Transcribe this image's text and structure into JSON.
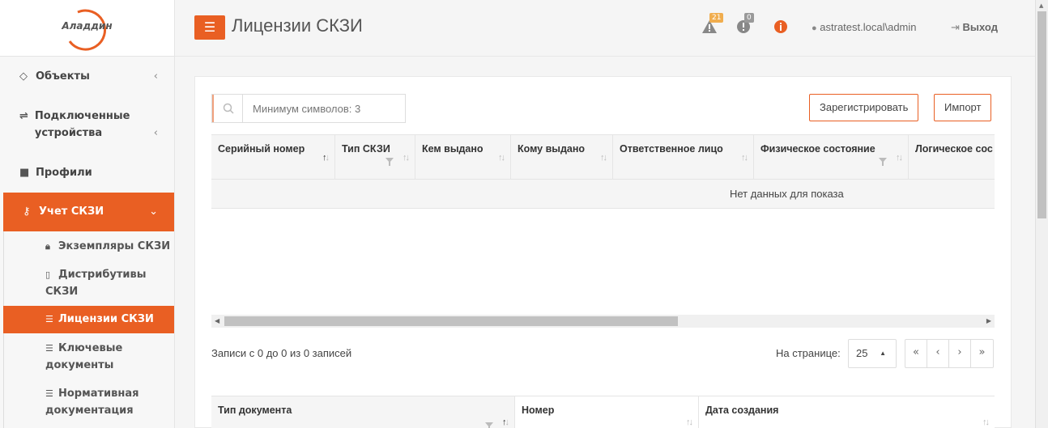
{
  "brand": {
    "logo_text": "Аладдин",
    "accent": "#e95f23"
  },
  "sidebar": {
    "items": [
      {
        "label": "Объекты",
        "icon": "diamond-icon",
        "chev": "‹"
      },
      {
        "label": "Подключенные устройства",
        "icon": "usb-icon",
        "chev": "‹"
      },
      {
        "label": "Профили",
        "icon": "folder-icon"
      },
      {
        "label": "Учет СКЗИ",
        "icon": "key-icon",
        "chev": "⌄"
      }
    ],
    "subitems": [
      {
        "label": "Экземпляры СКЗИ",
        "icon": "lock-icon"
      },
      {
        "label": "Дистрибутивы СКЗИ",
        "icon": "file-icon"
      },
      {
        "label": "Лицензии СКЗИ",
        "icon": "list-icon"
      },
      {
        "label": "Ключевые документы",
        "icon": "list-icon"
      },
      {
        "label": "Нормативная документация",
        "icon": "list-icon"
      }
    ]
  },
  "header": {
    "title": "Лицензии СКЗИ",
    "warnings_count": "21",
    "errors_count": "0",
    "user": "astratest.local\\admin",
    "logout": "Выход"
  },
  "toolbar": {
    "search_placeholder": "Минимум символов: 3",
    "register_label": "Зарегистрировать",
    "import_label": "Импорт"
  },
  "table": {
    "columns": [
      "Серийный номер",
      "Тип СКЗИ",
      "Кем выдано",
      "Кому выдано",
      "Ответственное лицо",
      "Физическое состояние",
      "Логическое сос"
    ],
    "empty_message": "Нет данных для показа"
  },
  "footer": {
    "records_info": "Записи с 0 до 0 из 0 записей",
    "per_page_label": "На странице:",
    "per_page_value": "25",
    "pager": [
      "«",
      "‹",
      "›",
      "»"
    ]
  },
  "table2": {
    "columns": [
      "Тип документа",
      "Номер",
      "Дата создания"
    ]
  }
}
